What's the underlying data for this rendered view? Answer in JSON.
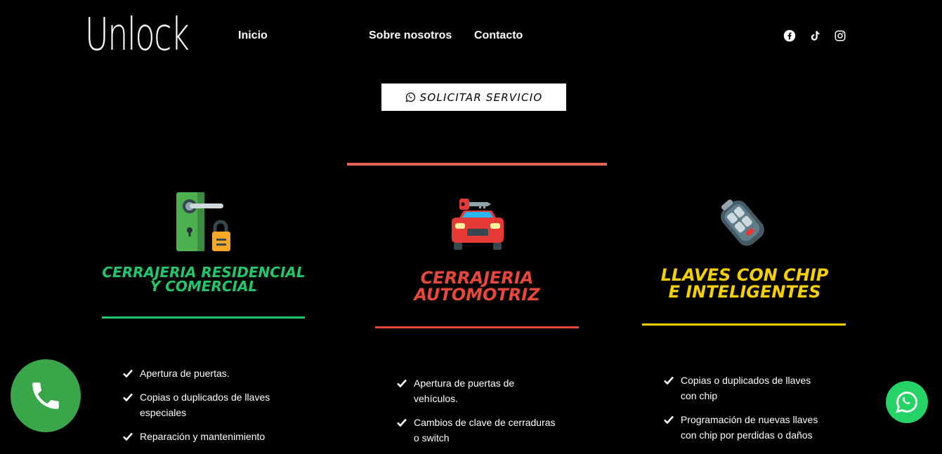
{
  "header": {
    "logo": "Unlock",
    "nav": [
      {
        "label": "Inicio"
      },
      {
        "label": "Sobre nosotros"
      },
      {
        "label": "Contacto"
      }
    ],
    "social": [
      "facebook-icon",
      "tiktok-icon",
      "instagram-icon"
    ]
  },
  "cta": {
    "label": "SOLICITAR SERVICIO",
    "icon": "whatsapp-icon"
  },
  "services": [
    {
      "title": "CERRAJERIA RESIDENCIAL Y COMERCIAL",
      "color": "#1fc86a",
      "icon": "door-lock-icon",
      "items": [
        "Apertura de puertas.",
        "Copias o duplicados de llaves especiales",
        "Reparación y mantenimiento"
      ]
    },
    {
      "title": "CERRAJERIA AUTOMOTRIZ",
      "color": "#e8483b",
      "icon": "car-key-icon",
      "items": [
        "Apertura de puertas de vehículos.",
        "Cambios de clave de cerraduras o switch"
      ]
    },
    {
      "title": "LLAVES CON CHIP E INTELIGENTES",
      "color": "#f5d000",
      "icon": "car-remote-icon",
      "items": [
        "Copias o duplicados de llaves con chip",
        "Programación de nuevas llaves con chip por perdidas o daños"
      ]
    }
  ],
  "colors": {
    "accent_top_bar": "#e8605a",
    "phone_button": "#3aa64a",
    "whatsapp_button": "#25d366"
  },
  "floating": {
    "phone": "phone-icon",
    "whatsapp": "whatsapp-icon"
  }
}
